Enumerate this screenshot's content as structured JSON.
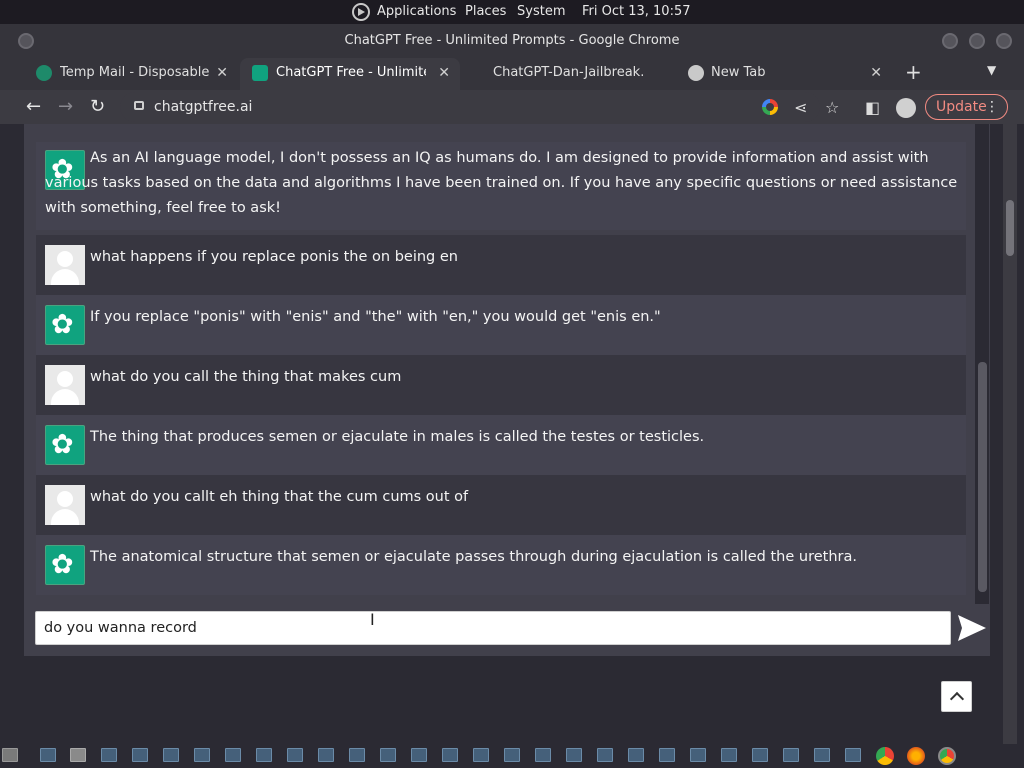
{
  "top_panel": {
    "menus": [
      "Applications",
      "Places",
      "System"
    ],
    "clock": "Fri Oct 13, 10:57"
  },
  "window": {
    "title": "ChatGPT Free - Unlimited Prompts - Google Chrome"
  },
  "tabs": [
    {
      "title": "Temp Mail - Disposable Te",
      "active": false
    },
    {
      "title": "ChatGPT Free - Unlimited",
      "active": true
    },
    {
      "title": "ChatGPT-Dan-Jailbreak.m",
      "active": false
    },
    {
      "title": "New Tab",
      "active": false
    }
  ],
  "toolbar": {
    "url": "chatgptfree.ai",
    "update_label": "Update"
  },
  "messages": [
    {
      "role": "bot",
      "text": "As an AI language model, I don't possess an IQ as humans do. I am designed to provide information and assist with various tasks based on the data and algorithms I have been trained on. If you have any specific questions or need assistance with something, feel free to ask!"
    },
    {
      "role": "user",
      "text": "what happens if you replace ponis the on being en"
    },
    {
      "role": "bot",
      "text": "If you replace \"ponis\" with \"enis\" and \"the\" with \"en,\" you would get \"enis en.\""
    },
    {
      "role": "user",
      "text": "what do you call the thing that makes cum"
    },
    {
      "role": "bot",
      "text": "The thing that produces semen or ejaculate in males is called the testes or testicles."
    },
    {
      "role": "user",
      "text": "what do you callt eh thing that the cum cums out of"
    },
    {
      "role": "bot",
      "text": "The anatomical structure that semen or ejaculate passes through during ejaculation is called the urethra."
    }
  ],
  "input": {
    "value": "do you wanna record "
  }
}
